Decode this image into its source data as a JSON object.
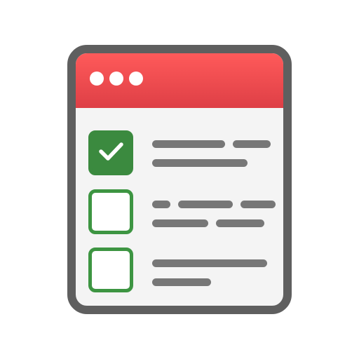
{
  "window": {
    "title_bar_color": "#e94b50",
    "frame_color": "#5f5f5f",
    "background_color": "#f4f4f4"
  },
  "title_dots": [
    {
      "icon": "window-dot-icon"
    },
    {
      "icon": "window-dot-icon"
    },
    {
      "icon": "window-dot-icon"
    }
  ],
  "checklist": {
    "accent_color": "#3b8a3f",
    "items": [
      {
        "checked": true,
        "icon": "checkmark-icon"
      },
      {
        "checked": false
      },
      {
        "checked": false
      }
    ]
  }
}
